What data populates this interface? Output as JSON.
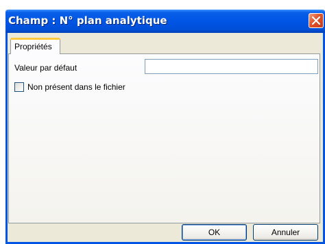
{
  "window": {
    "title": "Champ : N° plan analytique"
  },
  "tabs": [
    {
      "label": "Propriétés",
      "active": true
    }
  ],
  "form": {
    "default_value_label": "Valeur par défaut",
    "default_value": "",
    "not_in_file_label": "Non présent dans le fichier",
    "not_in_file_checked": false
  },
  "buttons": {
    "ok": "OK",
    "cancel": "Annuler"
  },
  "colors": {
    "titlebar": "#0055e5",
    "tab_highlight": "#ffc83c",
    "close": "#e0532b"
  }
}
